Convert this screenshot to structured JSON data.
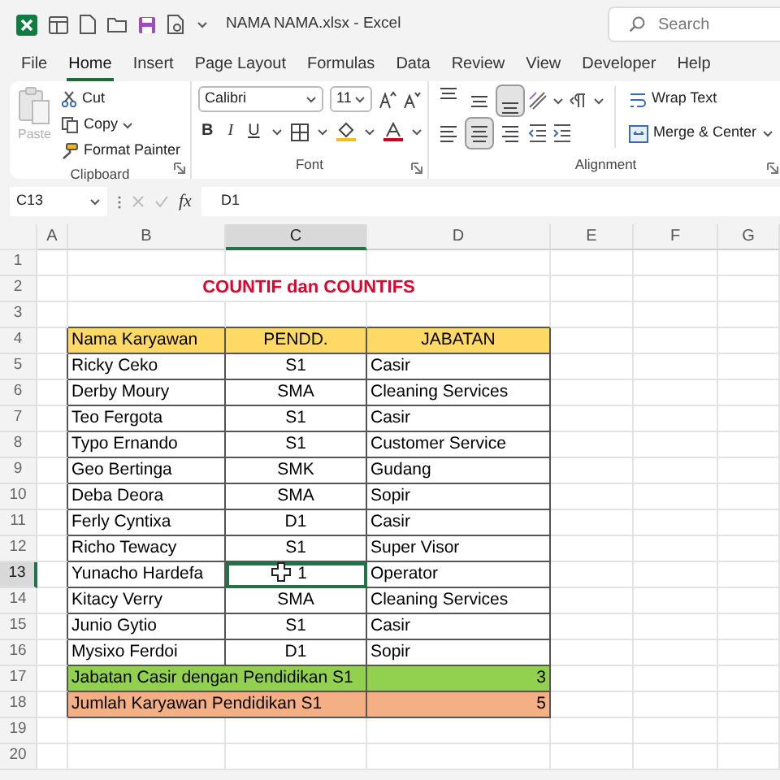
{
  "window": {
    "title": "NAMA NAMA.xlsx  -  Excel",
    "search_placeholder": "Search"
  },
  "menu_tabs": [
    {
      "label": "File",
      "selected": false
    },
    {
      "label": "Home",
      "selected": true
    },
    {
      "label": "Insert",
      "selected": false
    },
    {
      "label": "Page Layout",
      "selected": false
    },
    {
      "label": "Formulas",
      "selected": false
    },
    {
      "label": "Data",
      "selected": false
    },
    {
      "label": "Review",
      "selected": false
    },
    {
      "label": "View",
      "selected": false
    },
    {
      "label": "Developer",
      "selected": false
    },
    {
      "label": "Help",
      "selected": false
    }
  ],
  "ribbon": {
    "clipboard": {
      "label": "Clipboard",
      "paste": {
        "label": "Paste",
        "disabled": true
      },
      "cut": "Cut",
      "copy": "Copy",
      "format_painter": "Format Painter"
    },
    "font": {
      "label": "Font",
      "font_name": "Calibri",
      "font_size": "11",
      "bold": "B",
      "italic": "I",
      "underline": "U"
    },
    "alignment": {
      "label": "Alignment",
      "vertical": [
        {
          "kind": "top",
          "selected": false
        },
        {
          "kind": "middle",
          "selected": false
        },
        {
          "kind": "bottom",
          "selected": true
        }
      ],
      "horizontal": [
        {
          "kind": "left",
          "selected": false
        },
        {
          "kind": "center",
          "selected": true
        },
        {
          "kind": "right",
          "selected": false
        }
      ],
      "wrap_text": "Wrap Text",
      "merge": "Merge & Center"
    }
  },
  "formula_bar": {
    "name_box": "C13",
    "fx": "fx",
    "content": "D1"
  },
  "sheet": {
    "columns": [
      {
        "label": "A",
        "selected": false
      },
      {
        "label": "B",
        "selected": false
      },
      {
        "label": "C",
        "selected": true
      },
      {
        "label": "D",
        "selected": false
      },
      {
        "label": "E",
        "selected": false
      },
      {
        "label": "F",
        "selected": false
      },
      {
        "label": "G",
        "selected": false
      }
    ],
    "rows": [
      {
        "number": "1",
        "selected": false,
        "kind": "empty"
      },
      {
        "number": "2",
        "selected": false,
        "kind": "title",
        "text": "COUNTIF dan COUNTIFS"
      },
      {
        "number": "3",
        "selected": false,
        "kind": "empty"
      },
      {
        "number": "4",
        "selected": false,
        "kind": "header",
        "cells": [
          "Nama Karyawan",
          "PENDD.",
          "JABATAN"
        ]
      },
      {
        "number": "5",
        "selected": false,
        "kind": "data",
        "cells": [
          {
            "text": "Ricky Ceko",
            "selected": false
          },
          {
            "text": "S1",
            "selected": false
          },
          {
            "text": "Casir",
            "selected": false
          }
        ]
      },
      {
        "number": "6",
        "selected": false,
        "kind": "data",
        "cells": [
          {
            "text": "Derby Moury",
            "selected": false
          },
          {
            "text": "SMA",
            "selected": false
          },
          {
            "text": "Cleaning Services",
            "selected": false
          }
        ]
      },
      {
        "number": "7",
        "selected": false,
        "kind": "data",
        "cells": [
          {
            "text": "Teo Fergota",
            "selected": false
          },
          {
            "text": "S1",
            "selected": false
          },
          {
            "text": "Casir",
            "selected": false
          }
        ]
      },
      {
        "number": "8",
        "selected": false,
        "kind": "data",
        "cells": [
          {
            "text": "Typo Ernando",
            "selected": false
          },
          {
            "text": "S1",
            "selected": false
          },
          {
            "text": "Customer Service",
            "selected": false
          }
        ]
      },
      {
        "number": "9",
        "selected": false,
        "kind": "data",
        "cells": [
          {
            "text": "Geo Bertinga",
            "selected": false
          },
          {
            "text": "SMK",
            "selected": false
          },
          {
            "text": "Gudang",
            "selected": false
          }
        ]
      },
      {
        "number": "10",
        "selected": false,
        "kind": "data",
        "cells": [
          {
            "text": "Deba Deora",
            "selected": false
          },
          {
            "text": "SMA",
            "selected": false
          },
          {
            "text": "Sopir",
            "selected": false
          }
        ]
      },
      {
        "number": "11",
        "selected": false,
        "kind": "data",
        "cells": [
          {
            "text": "Ferly Cyntixa",
            "selected": false
          },
          {
            "text": "D1",
            "selected": false
          },
          {
            "text": "Casir",
            "selected": false
          }
        ]
      },
      {
        "number": "12",
        "selected": false,
        "kind": "data",
        "cells": [
          {
            "text": "Richo Tewacy",
            "selected": false
          },
          {
            "text": "S1",
            "selected": false
          },
          {
            "text": "Super Visor",
            "selected": false
          }
        ]
      },
      {
        "number": "13",
        "selected": true,
        "kind": "data",
        "cells": [
          {
            "text": "Yunacho Hardefa",
            "selected": false
          },
          {
            "text": "1",
            "selected": true
          },
          {
            "text": "Operator",
            "selected": false
          }
        ]
      },
      {
        "number": "14",
        "selected": false,
        "kind": "data",
        "cells": [
          {
            "text": "Kitacy Verry",
            "selected": false
          },
          {
            "text": "SMA",
            "selected": false
          },
          {
            "text": "Cleaning Services",
            "selected": false
          }
        ]
      },
      {
        "number": "15",
        "selected": false,
        "kind": "data",
        "cells": [
          {
            "text": "Junio Gytio",
            "selected": false
          },
          {
            "text": "S1",
            "selected": false
          },
          {
            "text": "Casir",
            "selected": false
          }
        ]
      },
      {
        "number": "16",
        "selected": false,
        "kind": "data",
        "cells": [
          {
            "text": "Mysixo Ferdoi",
            "selected": false
          },
          {
            "text": "D1",
            "selected": false
          },
          {
            "text": "Sopir",
            "selected": false
          }
        ]
      },
      {
        "number": "17",
        "selected": false,
        "kind": "summary",
        "label": "Jabatan Casir dengan Pendidikan S1",
        "value": "3",
        "color": "#92d050"
      },
      {
        "number": "18",
        "selected": false,
        "kind": "summary",
        "label": "Jumlah Karyawan Pendidikan S1",
        "value": "5",
        "color": "#f4b084"
      },
      {
        "number": "19",
        "selected": false,
        "kind": "empty"
      },
      {
        "number": "20",
        "selected": false,
        "kind": "empty"
      }
    ]
  }
}
